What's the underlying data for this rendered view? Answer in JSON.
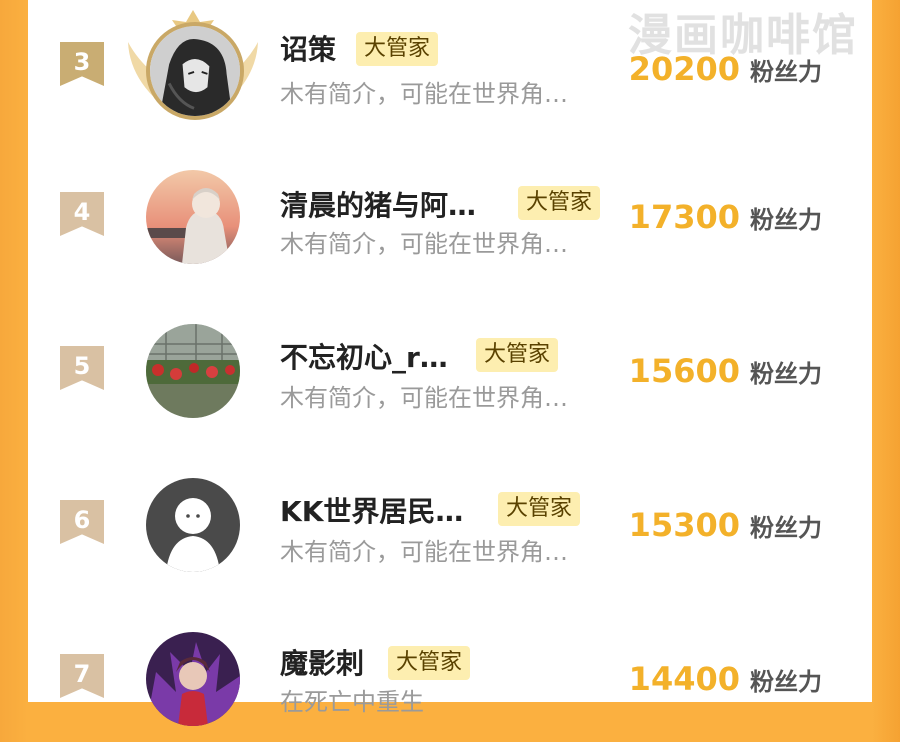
{
  "watermark": "漫画咖啡馆",
  "fans_unit": "粉丝力",
  "colors": {
    "accent": "#f3b12a",
    "badge_bg": "#fdeeb0",
    "frame": "#fbb040",
    "rank_badge": "#d9c1a3"
  },
  "rows": [
    {
      "rank": "3",
      "name": "诏策",
      "badge": "大管家",
      "desc": "木有简介，可能在世界角…",
      "fans": "20200",
      "avatar": "dark-anime-avatar",
      "crown": true
    },
    {
      "rank": "4",
      "name": "清晨的猪与阿…",
      "badge": "大管家",
      "desc": "木有简介，可能在世界角…",
      "fans": "17300",
      "avatar": "sunset-boy-avatar"
    },
    {
      "rank": "5",
      "name": "不忘初心_r…",
      "badge": "大管家",
      "desc": "木有简介，可能在世界角…",
      "fans": "15600",
      "avatar": "garden-flowers-avatar"
    },
    {
      "rank": "6",
      "name": "KK世界居民…",
      "badge": "大管家",
      "desc": "木有简介，可能在世界角…",
      "fans": "15300",
      "avatar": "default-person-avatar"
    },
    {
      "rank": "7",
      "name": "魔影刺",
      "badge": "大管家",
      "desc": "在死亡中重生",
      "fans": "14400",
      "avatar": "red-anime-avatar"
    }
  ]
}
